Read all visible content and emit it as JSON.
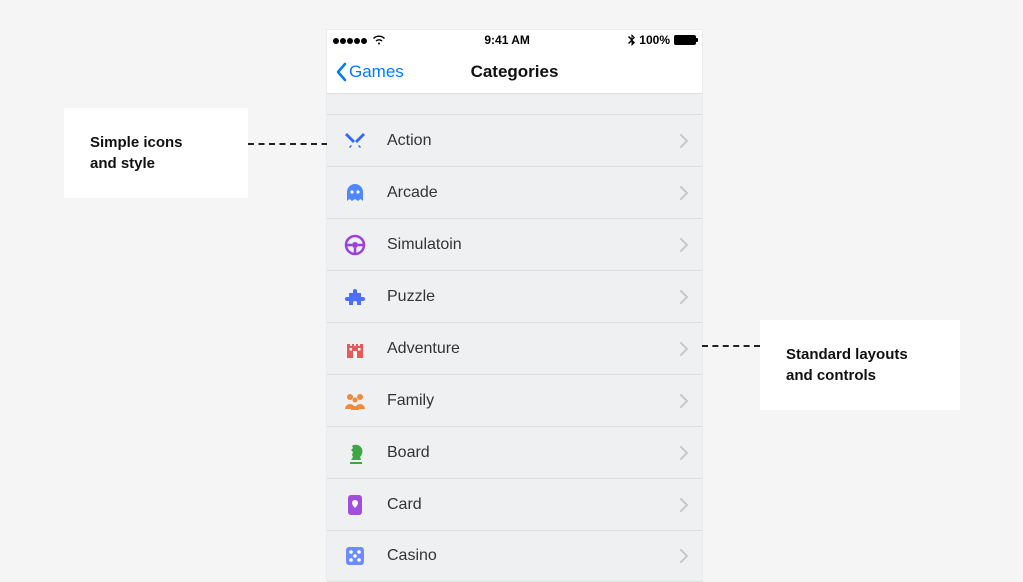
{
  "statusBar": {
    "time": "9:41 AM",
    "battery": "100%"
  },
  "nav": {
    "back": "Games",
    "title": "Categories"
  },
  "categories": [
    {
      "label": "Action",
      "icon": "swords",
      "color": "#2e68ff"
    },
    {
      "label": "Arcade",
      "icon": "ghost",
      "color": "#4d88ff"
    },
    {
      "label": "Simulatoin",
      "icon": "wheel",
      "color": "#9b3fe0"
    },
    {
      "label": "Puzzle",
      "icon": "puzzle",
      "color": "#4d6eff"
    },
    {
      "label": "Adventure",
      "icon": "castle",
      "color": "#e85a5a"
    },
    {
      "label": "Family",
      "icon": "people",
      "color": "#f08a3c"
    },
    {
      "label": "Board",
      "icon": "knight",
      "color": "#3fa648"
    },
    {
      "label": "Card",
      "icon": "card",
      "color": "#a14de0"
    },
    {
      "label": "Casino",
      "icon": "dice",
      "color": "#6b8cff"
    }
  ],
  "annotations": {
    "leftLine1": "Simple icons",
    "leftLine2": "and style",
    "rightLine1": "Standard layouts",
    "rightLine2": "and controls"
  }
}
